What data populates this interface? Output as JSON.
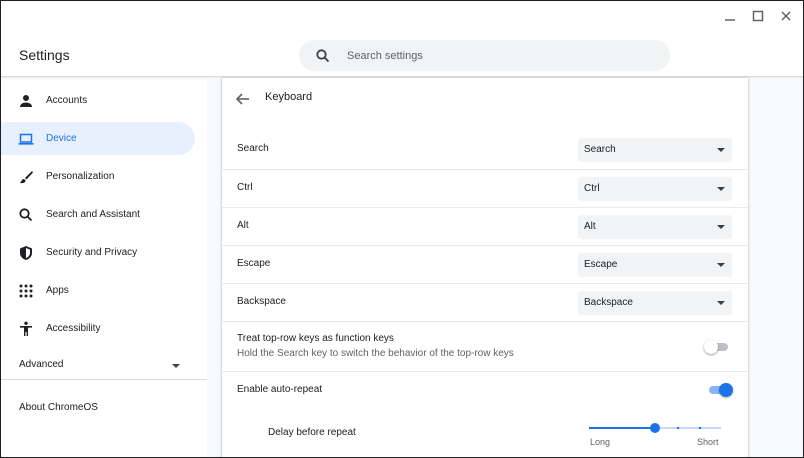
{
  "app": {
    "title": "Settings"
  },
  "window_controls": {
    "minimize_icon": "minimize-icon",
    "maximize_icon": "maximize-icon",
    "close_icon": "close-icon"
  },
  "search": {
    "placeholder": "Search settings",
    "value": ""
  },
  "sidebar": {
    "items": [
      {
        "label": "Accounts",
        "icon": "person-icon",
        "selected": false
      },
      {
        "label": "Device",
        "icon": "laptop-icon",
        "selected": true
      },
      {
        "label": "Personalization",
        "icon": "brush-icon",
        "selected": false
      },
      {
        "label": "Search and Assistant",
        "icon": "search-icon",
        "selected": false
      },
      {
        "label": "Security and Privacy",
        "icon": "shield-icon",
        "selected": false
      },
      {
        "label": "Apps",
        "icon": "apps-grid-icon",
        "selected": false
      },
      {
        "label": "Accessibility",
        "icon": "accessibility-icon",
        "selected": false
      }
    ],
    "advanced": "Advanced",
    "about": "About ChromeOS"
  },
  "page": {
    "title": "Keyboard",
    "key_mappings": [
      {
        "label": "Search",
        "value": "Search"
      },
      {
        "label": "Ctrl",
        "value": "Ctrl"
      },
      {
        "label": "Alt",
        "value": "Alt"
      },
      {
        "label": "Escape",
        "value": "Escape"
      },
      {
        "label": "Backspace",
        "value": "Backspace"
      }
    ],
    "top_row": {
      "label": "Treat top-row keys as function keys",
      "sublabel": "Hold the Search key to switch the behavior of the top-row keys",
      "enabled": false
    },
    "auto_repeat": {
      "label": "Enable auto-repeat",
      "enabled": true
    },
    "delay": {
      "label": "Delay before repeat",
      "min_label": "Long",
      "max_label": "Short",
      "level": 0.5
    }
  },
  "colors": {
    "accent": "#1a73e8",
    "selected_bg": "#e8f0fe",
    "search_bg": "#f1f3f4"
  }
}
